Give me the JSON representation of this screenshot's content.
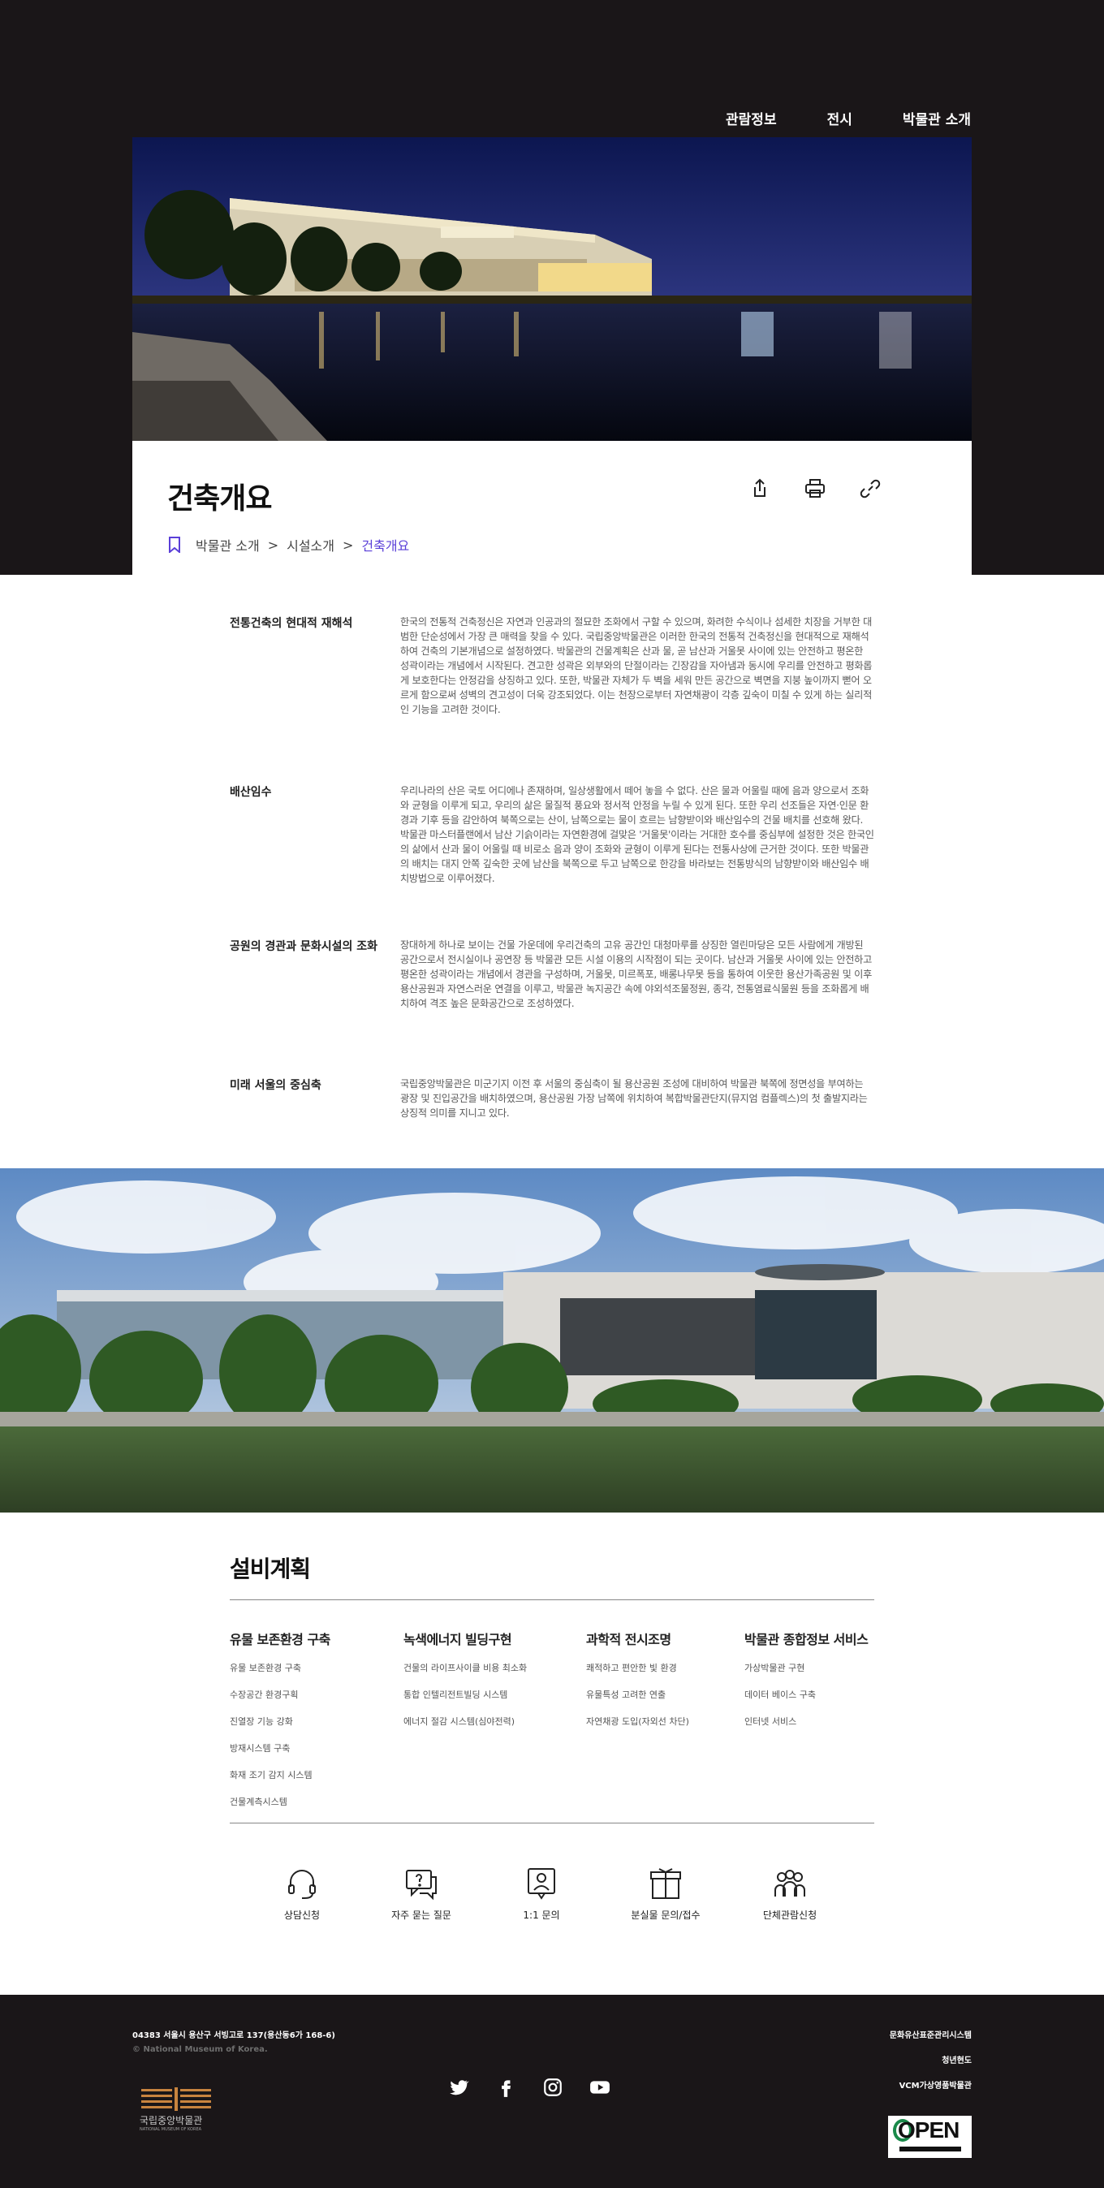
{
  "nav": {
    "items": [
      "관람정보",
      "전시",
      "박물관 소개"
    ]
  },
  "page": {
    "title": "건축개요"
  },
  "tools": {
    "share": "share-icon",
    "print": "print-icon",
    "link": "link-icon"
  },
  "breadcrumb": {
    "items": [
      "박물관 소개",
      "시설소개"
    ],
    "current": "건축개요",
    "sep": ">"
  },
  "sections": [
    {
      "heading": "전통건축의 현대적 재해석",
      "body": "한국의 전통적 건축정신은 자연과 인공과의 절묘한 조화에서 구할 수 있으며, 화려한 수식이나 섬세한 치장을 거부한 대범한 단순성에서 가장 큰 매력을 찾을 수 있다. 국립중앙박물관은 이러한 한국의 전통적 건축정신을 현대적으로 재해석하여 건축의 기본개념으로 설정하였다. 박물관의 건물계획은 산과 물, 곧 남산과 거울못 사이에 있는 안전하고 평온한 성곽이라는 개념에서 시작된다. 견고한 성곽은 외부와의 단절이라는 긴장감을 자아냄과 동시에 우리를 안전하고 평화롭게 보호한다는 안정감을 상징하고 있다. 또한, 박물관 자체가 두 벽을 세워 만든 공간으로 벽면을 지붕 높이까지 뻗어 오르게 함으로써 성벽의 견고성이 더욱 강조되었다. 이는 천장으로부터 자연채광이 각층 깊숙이 미칠 수 있게 하는 실리적인 기능을 고려한 것이다."
    },
    {
      "heading": "배산임수",
      "body": "우리나라의 산은 국토 어디에나 존재하며, 일상생활에서 떼어 놓을 수 없다. 산은 물과 어울릴 때에 음과 양으로서 조화와 균형을 이루게 되고, 우리의 삶은 물질적 풍요와 정서적 안정을 누릴 수 있게 된다. 또한 우리 선조들은 자연·인문 환경과 기후 등을 감안하여 북쪽으로는 산이, 남쪽으로는 물이 흐르는 남향받이와 배산임수의 건물 배치를 선호해 왔다. 박물관 마스터플랜에서 남산 기슭이라는 자연환경에 걸맞은 '거울못'이라는 거대한 호수를 중심부에 설정한 것은 한국인의 삶에서 산과 물이 어울릴 때 비로소 음과 양이 조화와 균형이 이루게 된다는 전통사상에 근거한 것이다. 또한 박물관의 배치는 대지 안쪽 깊숙한 곳에 남산을 북쪽으로 두고 남쪽으로 한강을 바라보는 전통방식의 남향받이와 배산임수 배치방법으로 이루어졌다."
    },
    {
      "heading": "공원의 경관과 문화시설의 조화",
      "body": "장대하게 하나로 보이는 건물 가운데에 우리건축의 고유 공간인 대청마루를 상징한 열린마당은 모든 사람에게 개방된 공간으로서 전시실이나 공연장 등 박물관 모든 시설 이용의 시작점이 되는 곳이다. 남산과 거울못 사이에 있는 안전하고 평온한 성곽이라는 개념에서 경관을 구성하며, 거울못, 미르폭포, 배롱나무못 등을 통하여 이웃한 용산가족공원 및 이후 용산공원과 자연스러운 연결을 이루고, 박물관 녹지공간 속에 야외석조물정원, 종각, 전통염료식물원 등을 조화롭게 배치하여 격조 높은 문화공간으로 조성하였다."
    },
    {
      "heading": "미래 서울의 중심축",
      "body": "국립중앙박물관은 미군기지 이전 후 서울의 중심축이 될 용산공원 조성에 대비하여 박물관 북쪽에 정면성을 부여하는 광장 및 진입공간을 배치하였으며, 용산공원 가장 남쪽에 위치하여 복합박물관단지(뮤지엄 컴플렉스)의 첫 출발지라는 상징적 의미를 지니고 있다."
    }
  ],
  "facilities": {
    "title": "설비계획",
    "columns": [
      {
        "title": "유물 보존환경 구축",
        "items": [
          "유물 보존환경 구축",
          "수장공간 환경구획",
          "진열장 기능 강화",
          "방재시스템 구축",
          "화재 조기 감지 시스템",
          "건물계측시스템"
        ]
      },
      {
        "title": "녹색에너지 빌딩구현",
        "items": [
          "건물의 라이프사이클 비용 최소화",
          "통합 인텔리전트빌딩 시스템",
          "에너지 절감 시스템(심야전력)"
        ]
      },
      {
        "title": "과학적 전시조명",
        "items": [
          "쾌적하고 편안한 빛 환경",
          "유물특성 고려한 연출",
          "자연채광 도입(자외선 차단)"
        ]
      },
      {
        "title": "박물관 종합정보 서비스",
        "items": [
          "가상박물관 구현",
          "데이터 베이스 구축",
          "인터넷 서비스"
        ]
      }
    ]
  },
  "services": [
    {
      "label": "상담신청",
      "icon": "headset-icon"
    },
    {
      "label": "자주 묻는 질문",
      "icon": "faq-icon"
    },
    {
      "label": "1:1 문의",
      "icon": "person-inquiry-icon"
    },
    {
      "label": "분실물 문의/접수",
      "icon": "box-icon"
    },
    {
      "label": "단체관람신청",
      "icon": "group-icon"
    }
  ],
  "footer": {
    "address": "04383 서울시 용산구 서빙고로 137(용산동6가 168-6)",
    "copyright": "© National Museum of Korea.",
    "logo_text": "국립중앙박물관",
    "logo_sub": "NATIONAL MUSEUM OF KOREA",
    "links": [
      "문화유산표준관리시스템",
      "청년현도",
      "VCM가상영품박물관"
    ],
    "social": [
      "twitter-icon",
      "facebook-icon",
      "instagram-icon",
      "youtube-icon"
    ],
    "badge": "OPEN"
  },
  "colors": {
    "dark": "#1a1618",
    "accent": "#5a3fd8",
    "text": "#222222"
  }
}
